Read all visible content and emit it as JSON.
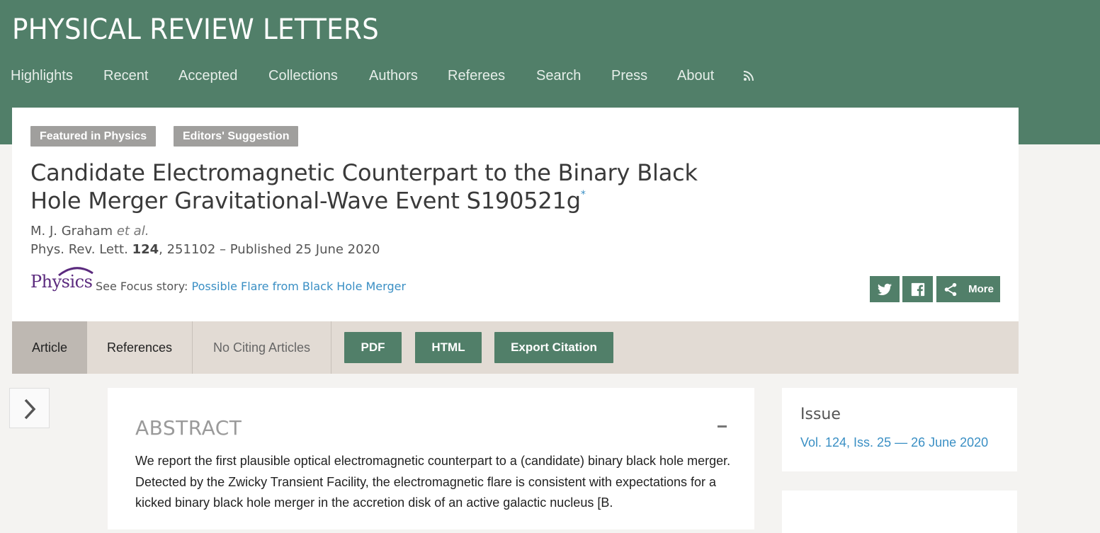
{
  "header": {
    "journal": "PHYSICAL REVIEW LETTERS",
    "nav": [
      "Highlights",
      "Recent",
      "Accepted",
      "Collections",
      "Authors",
      "Referees",
      "Search",
      "Press",
      "About"
    ],
    "rss_icon": "rss-icon"
  },
  "article": {
    "badges": [
      "Featured in Physics",
      "Editors' Suggestion"
    ],
    "title": "Candidate Electromagnetic Counterpart to the Binary Black Hole Merger Gravitational-Wave Event S190521g",
    "title_marker": "*",
    "authors": "M. J. Graham",
    "authors_suffix": "et al.",
    "citation": {
      "journal": "Phys. Rev. Lett.",
      "volume": "124",
      "rest": ", 251102 – Published 25 June 2020"
    },
    "physics": {
      "logo": "Physics",
      "see": "See Focus story:",
      "link": "Possible Flare from Black Hole Merger"
    },
    "share": {
      "twitter_icon": "twitter-icon",
      "facebook_icon": "facebook-icon",
      "share_icon": "share-icon",
      "more": "More"
    }
  },
  "tabs": {
    "article": "Article",
    "references": "References",
    "citing": "No Citing Articles",
    "pdf": "PDF",
    "html": "HTML",
    "export": "Export Citation"
  },
  "abstract": {
    "heading": "ABSTRACT",
    "collapse": "-",
    "text": "We report the first plausible optical electromagnetic counterpart to a (candidate) binary black hole merger. Detected by the Zwicky Transient Facility, the electromagnetic flare is consistent with expectations for a kicked binary black hole merger in the accretion disk of an active galactic nucleus [B."
  },
  "issue": {
    "label": "Issue",
    "link": "Vol. 124, Iss. 25 — 26 June 2020"
  },
  "colors": {
    "brand_green": "#517f69",
    "link_blue": "#3a8fc4",
    "physics_purple": "#5b2a7e",
    "tab_bar": "#e2dbd4"
  }
}
